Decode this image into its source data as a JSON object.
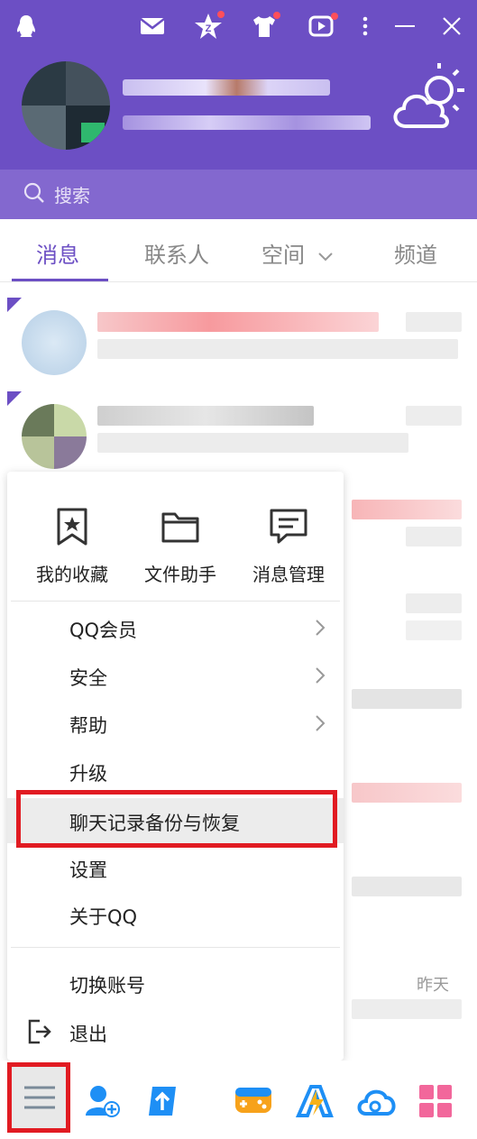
{
  "search": {
    "placeholder": "搜索"
  },
  "tabs": [
    {
      "label": "消息"
    },
    {
      "label": "联系人"
    },
    {
      "label": "空间"
    },
    {
      "label": "频道"
    }
  ],
  "menu": {
    "quick_actions": [
      {
        "label": "我的收藏",
        "icon": "star-bookmark-icon"
      },
      {
        "label": "文件助手",
        "icon": "folder-icon"
      },
      {
        "label": "消息管理",
        "icon": "message-icon"
      }
    ],
    "items": [
      {
        "label": "QQ会员",
        "has_submenu": true
      },
      {
        "label": "安全",
        "has_submenu": true
      },
      {
        "label": "帮助",
        "has_submenu": true
      },
      {
        "label": "升级",
        "has_submenu": false
      },
      {
        "label": "聊天记录备份与恢复",
        "has_submenu": false,
        "highlighted": true
      },
      {
        "label": "设置",
        "has_submenu": false
      },
      {
        "label": "关于QQ",
        "has_submenu": false
      },
      {
        "label": "切换账号",
        "has_submenu": false
      },
      {
        "label": "退出",
        "has_submenu": false
      }
    ]
  },
  "conversations": {
    "time_labels": [
      "昨天"
    ]
  },
  "colors": {
    "brand": "#6c4fc4",
    "highlight_box": "#e11b22",
    "badge": "#ff4f5a"
  }
}
